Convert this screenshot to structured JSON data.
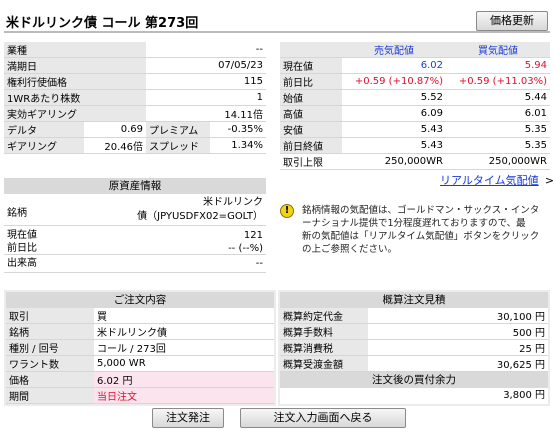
{
  "header": {
    "title": "米ドルリンク債 コール 第273回",
    "price_update_button": "価格更新"
  },
  "info": {
    "rows": [
      {
        "label": "業種",
        "value": "--"
      },
      {
        "label": "満期日",
        "value": "07/05/23"
      },
      {
        "label": "権利行使価格",
        "value": "115"
      },
      {
        "label": "1WRあたり株数",
        "value": "1"
      },
      {
        "label": "実効ギアリング",
        "value": "14.11倍"
      }
    ],
    "split_rows": [
      {
        "label1": "デルタ",
        "value1": "0.69",
        "label2": "プレミアム",
        "value2": "-0.35%"
      },
      {
        "label1": "ギアリング",
        "value1": "20.46倍",
        "label2": "スプレッド",
        "value2": "1.34%"
      }
    ]
  },
  "quotes": {
    "header_sell": "売気配値",
    "header_buy": "買気配値",
    "rows": [
      {
        "label": "現在値",
        "sell": "6.02",
        "buy": "5.94"
      },
      {
        "label": "前日比",
        "sell": "+0.59 (+10.87%)",
        "buy": "+0.59 (+11.03%)"
      },
      {
        "label": "始値",
        "sell": "5.52",
        "buy": "5.44"
      },
      {
        "label": "高値",
        "sell": "6.09",
        "buy": "6.01"
      },
      {
        "label": "安値",
        "sell": "5.43",
        "buy": "5.35"
      },
      {
        "label": "前日終値",
        "sell": "5.43",
        "buy": "5.35"
      },
      {
        "label": "取引上限",
        "sell": "250,000WR",
        "buy": "250,000WR"
      }
    ],
    "realtime_link": "リアルタイム気配値",
    "link_arrow": ">"
  },
  "underlying": {
    "section_title": "原資産情報",
    "brand_label": "銘柄",
    "brand_value_line1": "米ドルリンク",
    "brand_value_line2": "債（JPYUSDFX02=GOLT）",
    "price_label": "現在値",
    "price_value": "121",
    "change_label": "前日比",
    "change_value": "-- (--%)",
    "volume_label": "出来高",
    "volume_value": "--"
  },
  "notice": {
    "icon": "!",
    "lines": [
      "銘柄情報の気配値は、ゴールドマン・サックス・インタ",
      "ーナショナル提供で1分程度遅れておりますので、最",
      "新の気配値は「リアルタイム気配値」ボタンをクリック",
      "の上ご参照ください。"
    ]
  },
  "order": {
    "section_title": "ご注文内容",
    "rows": [
      {
        "label": "取引",
        "value": "買"
      },
      {
        "label": "銘柄",
        "value": "米ドルリンク債"
      },
      {
        "label": "種別 / 回号",
        "value": "コール / 273回"
      },
      {
        "label": "ワラント数",
        "value": "5,000 WR"
      },
      {
        "label": "価格",
        "value": "6.02 円"
      },
      {
        "label": "期間",
        "value": "当日注文"
      }
    ]
  },
  "estimate": {
    "section_title": "概算注文見積",
    "rows": [
      {
        "label": "概算約定代金",
        "value": "30,100 円"
      },
      {
        "label": "概算手数料",
        "value": "500 円"
      },
      {
        "label": "概算消費税",
        "value": "25 円"
      },
      {
        "label": "概算受渡金額",
        "value": "30,625 円"
      }
    ],
    "after_title": "注文後の買付余力",
    "after_value": "3,800 円"
  },
  "buttons": {
    "submit": "注文発注",
    "back": "注文入力画面へ戻る"
  },
  "colors": {
    "accent_blue": "#1a3ad4",
    "accent_red": "#e0102a",
    "label_gray": "#e8e8e8",
    "highlight_pink": "#fce4ef"
  }
}
